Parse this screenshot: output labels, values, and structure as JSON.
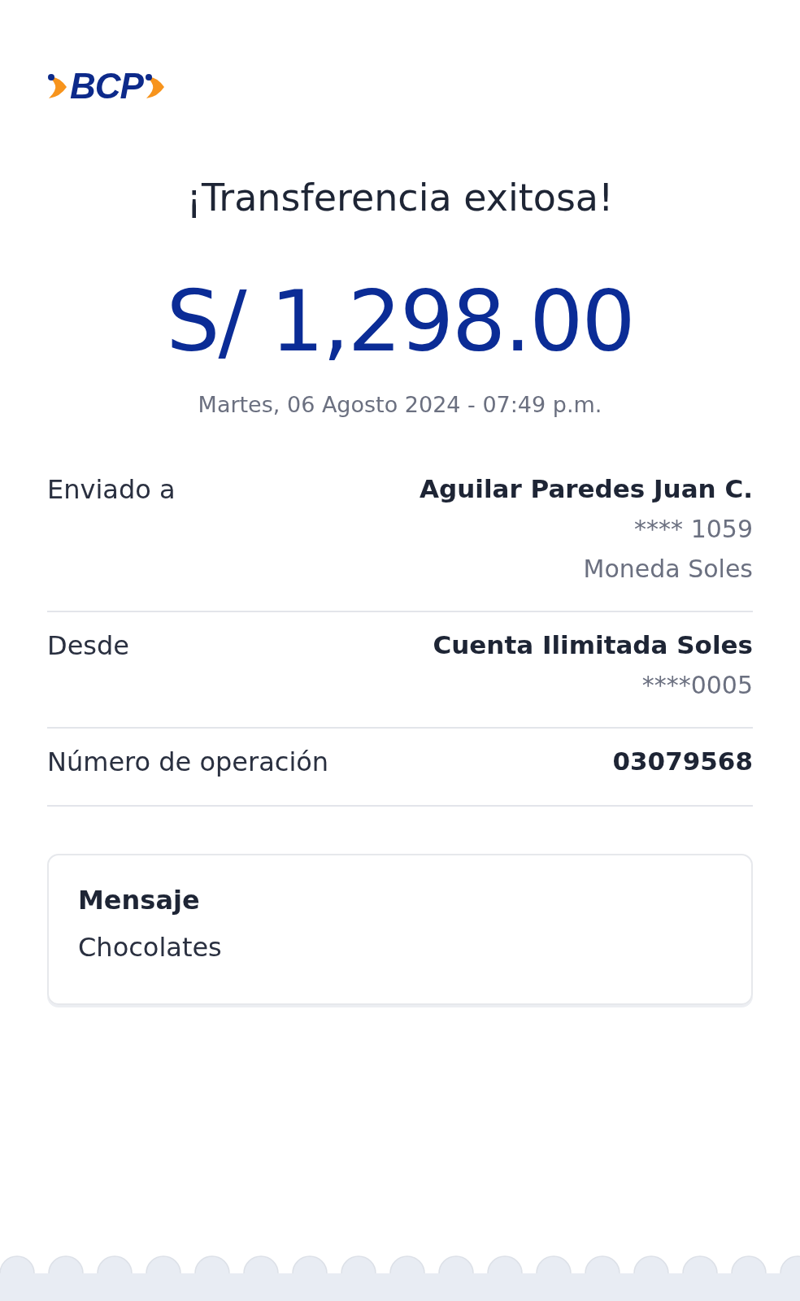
{
  "logo": {
    "text": "BCP"
  },
  "title": "¡Transferencia exitosa!",
  "amount": "S/ 1,298.00",
  "datetime": "Martes, 06 Agosto 2024 - 07:49 p.m.",
  "details": [
    {
      "label": "Enviado a",
      "values": [
        "Aguilar Paredes Juan C.",
        "**** 1059",
        "Moneda Soles"
      ]
    },
    {
      "label": "Desde",
      "values": [
        "Cuenta Ilimitada Soles",
        "****0005"
      ]
    },
    {
      "label": "Número de operación",
      "values": [
        "03079568"
      ]
    }
  ],
  "message": {
    "label": "Mensaje",
    "text": "Chocolates"
  }
}
